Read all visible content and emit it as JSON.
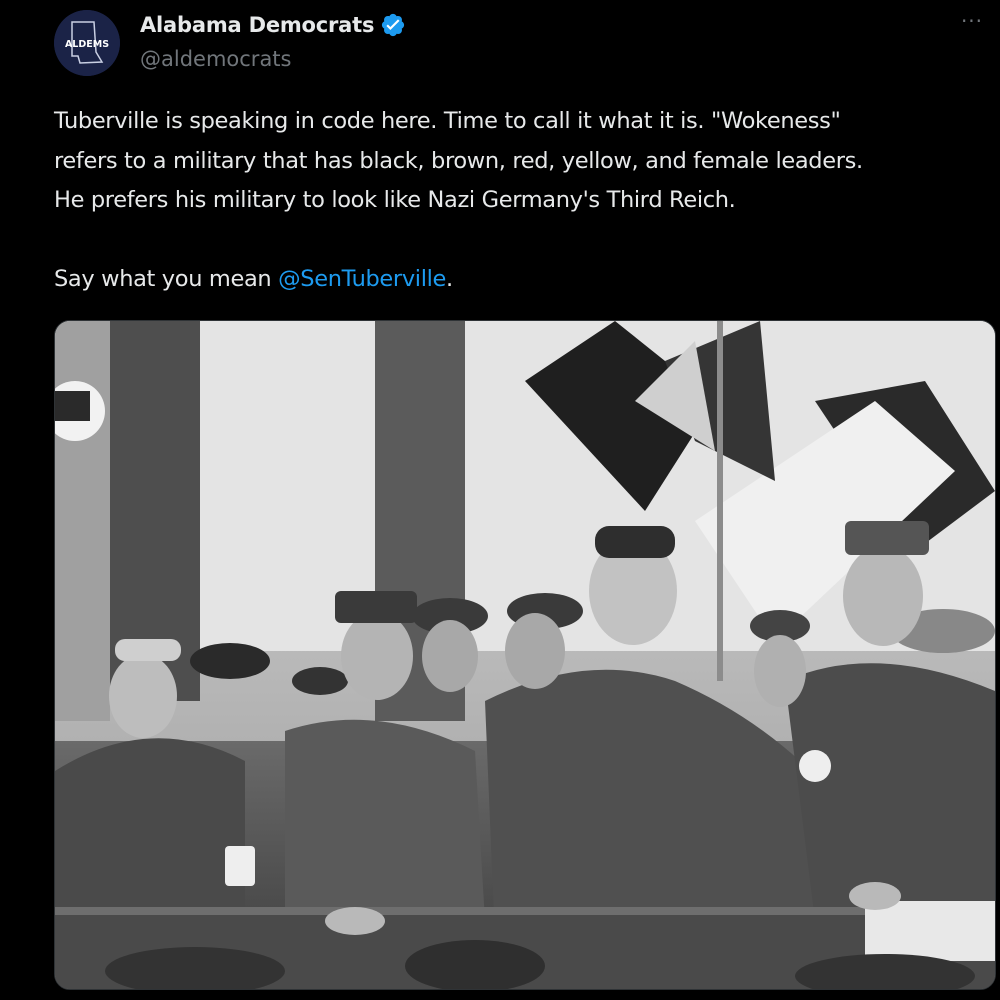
{
  "author": {
    "avatar_text": "ALDEMS",
    "display_name": "Alabama Democrats",
    "handle": "@aldemocrats",
    "verified_icon": "verified-badge-icon",
    "verified_color": "#1d9bf0"
  },
  "menu": {
    "more_icon": "more-options-icon",
    "more_label": "···"
  },
  "tweet": {
    "lines": [
      "Tuberville is speaking in code here.  Time to call it what it is.  \"Wokeness\"",
      "refers to a military that has black, brown, red, yellow, and female leaders.",
      "He prefers his military to look like Nazi Germany's Third Reich."
    ],
    "closing_prefix": "Say what you mean ",
    "mention": "@SenTuberville",
    "closing_suffix": "."
  },
  "media": {
    "type": "photo",
    "style": "black-and-white"
  },
  "colors": {
    "background": "#000000",
    "text": "#e7e9ea",
    "secondary": "#71767b",
    "link": "#1d9bf0"
  }
}
